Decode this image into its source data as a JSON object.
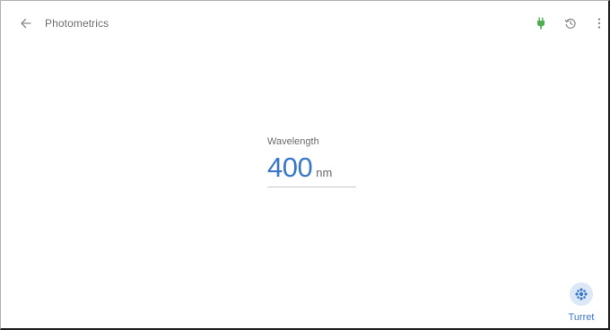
{
  "header": {
    "title": "Photometrics",
    "icons": {
      "back": "arrow-left-icon",
      "power": "plug-icon",
      "history": "history-icon",
      "menu": "more-vert-icon"
    },
    "status_color": "#4caf50"
  },
  "wavelength": {
    "label": "Wavelength",
    "value": "400",
    "unit": "nm"
  },
  "turret": {
    "label": "Turret",
    "icon": "turret-icon"
  },
  "colors": {
    "accent": "#3a78c9",
    "accent_light": "#dce8f7"
  }
}
